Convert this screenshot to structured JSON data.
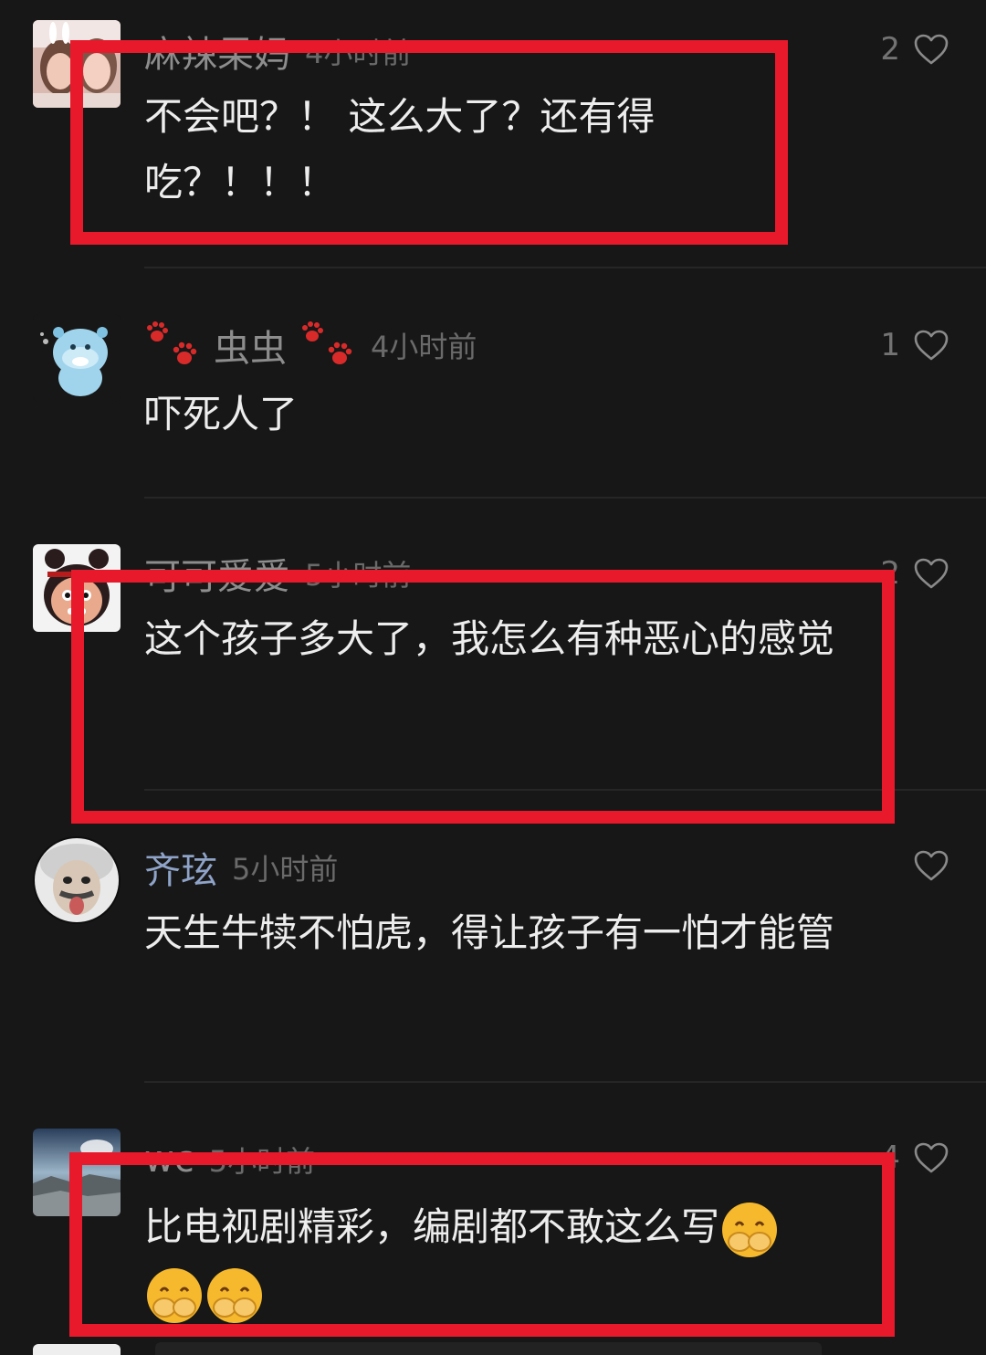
{
  "comments": [
    {
      "user": "麻辣果妈",
      "time": "4小时前",
      "text": "不会吧？！ 这么大了？还有得吃？！！！",
      "likes": "2"
    },
    {
      "user": "虫虫",
      "time": "4小时前",
      "text": "吓死人了",
      "likes": "1"
    },
    {
      "user": "可可爱爱",
      "time": "5小时前",
      "text": "这个孩子多大了，我怎么有种恶心的感觉",
      "likes": "2"
    },
    {
      "user": "齐玹",
      "time": "5小时前",
      "text": "天生牛犊不怕虎，得让孩子有一怕才能管",
      "likes": ""
    },
    {
      "user": "wc",
      "time": "5小时前",
      "text": "比电视剧精彩，编剧都不敢这么写",
      "likes": "4"
    }
  ],
  "icons": {
    "like": "heart-outline-icon",
    "paw": "paw-prints-icon",
    "emoji": "hand-over-mouth-emoji"
  },
  "colors": {
    "background": "#171717",
    "highlight_box": "#e8192b",
    "comment_text": "#ededed",
    "username": "#8d8d8d",
    "username_highlight": "#8ea3c7"
  }
}
